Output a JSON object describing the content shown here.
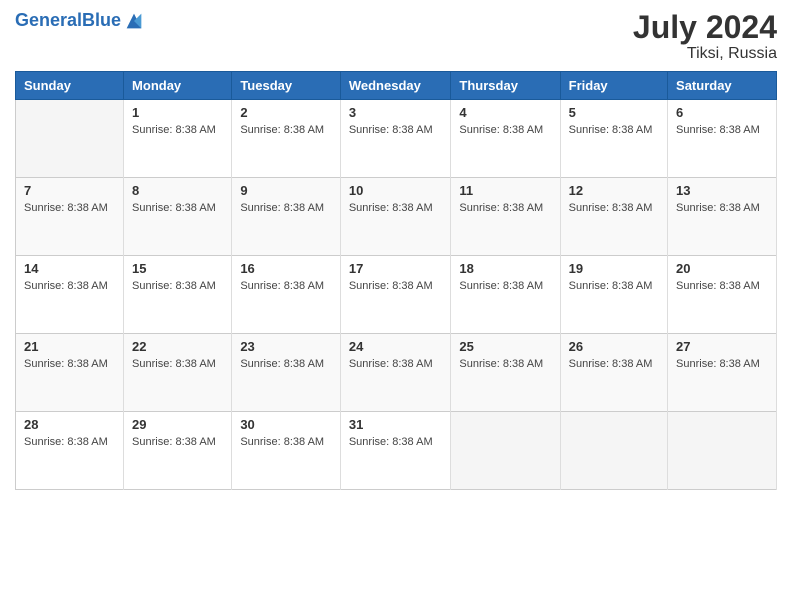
{
  "logo": {
    "text_general": "General",
    "text_blue": "Blue"
  },
  "header": {
    "month_year": "July 2024",
    "location": "Tiksi, Russia"
  },
  "weekdays": [
    "Sunday",
    "Monday",
    "Tuesday",
    "Wednesday",
    "Thursday",
    "Friday",
    "Saturday"
  ],
  "sunrise": "Sunrise: 8:38 AM",
  "weeks": [
    [
      {
        "day": "",
        "empty": true
      },
      {
        "day": "1",
        "info": "Sunrise: 8:38 AM"
      },
      {
        "day": "2",
        "info": "Sunrise: 8:38 AM"
      },
      {
        "day": "3",
        "info": "Sunrise: 8:38 AM"
      },
      {
        "day": "4",
        "info": "Sunrise: 8:38 AM"
      },
      {
        "day": "5",
        "info": "Sunrise: 8:38 AM"
      },
      {
        "day": "6",
        "info": "Sunrise: 8:38 AM"
      }
    ],
    [
      {
        "day": "7",
        "info": "Sunrise: 8:38 AM"
      },
      {
        "day": "8",
        "info": "Sunrise: 8:38 AM"
      },
      {
        "day": "9",
        "info": "Sunrise: 8:38 AM"
      },
      {
        "day": "10",
        "info": "Sunrise: 8:38 AM"
      },
      {
        "day": "11",
        "info": "Sunrise: 8:38 AM"
      },
      {
        "day": "12",
        "info": "Sunrise: 8:38 AM"
      },
      {
        "day": "13",
        "info": "Sunrise: 8:38 AM"
      }
    ],
    [
      {
        "day": "14",
        "info": "Sunrise: 8:38 AM"
      },
      {
        "day": "15",
        "info": "Sunrise: 8:38 AM"
      },
      {
        "day": "16",
        "info": "Sunrise: 8:38 AM"
      },
      {
        "day": "17",
        "info": "Sunrise: 8:38 AM"
      },
      {
        "day": "18",
        "info": "Sunrise: 8:38 AM"
      },
      {
        "day": "19",
        "info": "Sunrise: 8:38 AM"
      },
      {
        "day": "20",
        "info": "Sunrise: 8:38 AM"
      }
    ],
    [
      {
        "day": "21",
        "info": "Sunrise: 8:38 AM"
      },
      {
        "day": "22",
        "info": "Sunrise: 8:38 AM"
      },
      {
        "day": "23",
        "info": "Sunrise: 8:38 AM"
      },
      {
        "day": "24",
        "info": "Sunrise: 8:38 AM"
      },
      {
        "day": "25",
        "info": "Sunrise: 8:38 AM"
      },
      {
        "day": "26",
        "info": "Sunrise: 8:38 AM"
      },
      {
        "day": "27",
        "info": "Sunrise: 8:38 AM"
      }
    ],
    [
      {
        "day": "28",
        "info": "Sunrise: 8:38 AM"
      },
      {
        "day": "29",
        "info": "Sunrise: 8:38 AM"
      },
      {
        "day": "30",
        "info": "Sunrise: 8:38 AM"
      },
      {
        "day": "31",
        "info": "Sunrise: 8:38 AM"
      },
      {
        "day": "",
        "empty": true
      },
      {
        "day": "",
        "empty": true
      },
      {
        "day": "",
        "empty": true
      }
    ]
  ]
}
